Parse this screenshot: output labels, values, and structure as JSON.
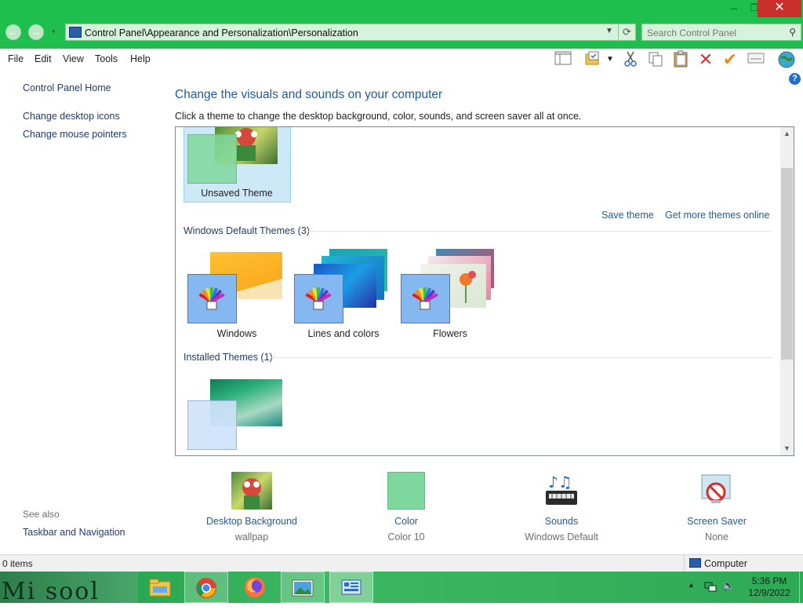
{
  "window": {
    "minimize": "–",
    "restore": "❐",
    "close": "✕"
  },
  "nav": {
    "back": "←",
    "forward": "→",
    "dropdown": "▾"
  },
  "address": {
    "path": "Control Panel\\Appearance and Personalization\\Personalization",
    "icon": "control-panel-icon"
  },
  "search": {
    "placeholder": "Search Control Panel",
    "icon": "magnifier-icon"
  },
  "menu": {
    "items": [
      "File",
      "Edit",
      "View",
      "Tools",
      "Help"
    ]
  },
  "toolbar": {
    "icons": [
      "layout-icon",
      "folder-options-icon",
      "cut-icon",
      "copy-icon",
      "paste-icon",
      "delete-icon",
      "apply-icon",
      "properties-icon",
      "globe-icon"
    ],
    "help": "?"
  },
  "left": {
    "home": "Control Panel Home",
    "links": [
      "Change desktop icons",
      "Change mouse pointers"
    ],
    "see_also_title": "See also",
    "see_also_links": [
      "Taskbar and Navigation"
    ]
  },
  "main": {
    "heading": "Change the visuals and sounds on your computer",
    "subheading": "Click a theme to change the desktop background, color, sounds, and screen saver all at once.",
    "unsaved_theme": "Unsaved Theme",
    "save_theme": "Save theme",
    "get_more": "Get more themes online",
    "default_section": "Windows Default Themes (3)",
    "default_themes": [
      "Windows",
      "Lines and colors",
      "Flowers"
    ],
    "installed_section": "Installed Themes (1)"
  },
  "settings": [
    {
      "label": "Desktop Background",
      "value": "wallpap"
    },
    {
      "label": "Color",
      "value": "Color 10"
    },
    {
      "label": "Sounds",
      "value": "Windows Default"
    },
    {
      "label": "Screen Saver",
      "value": "None"
    }
  ],
  "status": {
    "items": "0 items",
    "location": "Computer"
  },
  "taskbar": {
    "wallpaper_text": "Mi sool",
    "apps": [
      "file-explorer-icon",
      "chrome-icon",
      "firefox-icon",
      "photo-viewer-icon",
      "control-panel-icon"
    ],
    "time": "5:36 PM",
    "date": "12/9/2022"
  },
  "colors": {
    "title_green": "#1fbf4e",
    "link_blue": "#1e5b9c",
    "color_swatch": "#7ed79c",
    "selected_bg": "#cde8f7"
  }
}
